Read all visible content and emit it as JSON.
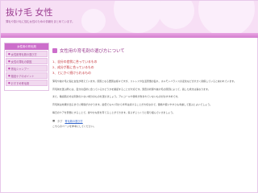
{
  "site": {
    "title": "抜け毛 女性",
    "description": "薄毛や抜け毛に悩む女性のための情報をまとめています。"
  },
  "sidebar": {
    "heading": "女性用の育毛剤",
    "items": [
      {
        "label": "女性用育毛剤の選び方"
      },
      {
        "label": "女性の薄毛の原因"
      },
      {
        "label": "育毛シャンプー"
      },
      {
        "label": "頭皮ケアのポイント"
      },
      {
        "label": "おすすめ育毛剤"
      }
    ]
  },
  "post": {
    "title": "女性用の育毛剤の選び方について",
    "toc": [
      "1、自分の症状に合っているもの",
      "2、成分が肌に合っているもの",
      "3、とにかく続けられるもの"
    ],
    "paragraphs": [
      "薄毛や抜け毛に悩む女性が増えています。原因となる要因は様々ですが、ストレスや生活習慣の乱れ、ホルモンバランスの変化などが大きく関係していると言われています。",
      "育毛剤を選ぶ際には、自分の症状に合っているかどうかを確認することが大切です。頭皮の状態や抜け毛の原因によって、適した成分は異なります。",
      "また、敏感肌の方は刺激の少ない成分のものを選びましょう。アルコールや香料が含まれていないものがおすすめです。",
      "育毛剤は効果が出るまでに時間がかかります。最低でも3ヶ月から半年は続けることが大切なので、価格や使いやすさも考慮して選ぶとよいでしょう。",
      "毎日のケアを習慣にすることで、健やかな髪を育てることができます。焦らずじっくりと取り組んでいきましょう。"
    ],
    "tags_label": "タグ",
    "tag": "育毛剤の選び方",
    "note": "こちらのページを参考にしてください。"
  }
}
